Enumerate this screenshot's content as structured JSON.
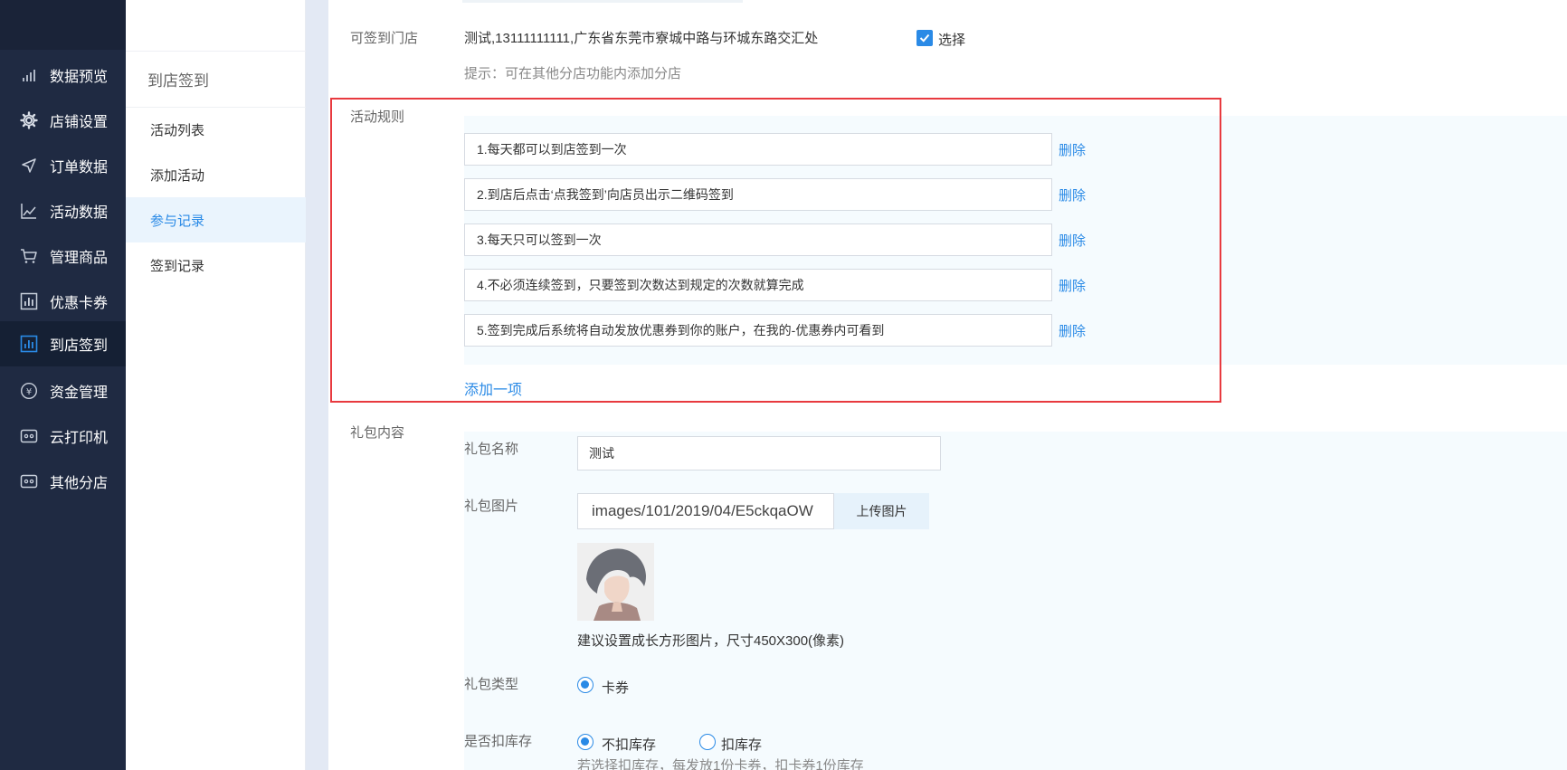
{
  "sidebar": {
    "items": [
      {
        "label": "数据预览",
        "icon": "bar-chart-small-icon"
      },
      {
        "label": "店铺设置",
        "icon": "gear-icon"
      },
      {
        "label": "订单数据",
        "icon": "send-arrow-icon"
      },
      {
        "label": "活动数据",
        "icon": "line-chart-icon"
      },
      {
        "label": "管理商品",
        "icon": "cart-icon"
      },
      {
        "label": "优惠卡券",
        "icon": "stats-box-icon"
      },
      {
        "label": "到店签到",
        "icon": "stats-box-icon"
      },
      {
        "label": "资金管理",
        "icon": "yen-circle-icon"
      },
      {
        "label": "云打印机",
        "icon": "printer-icon"
      },
      {
        "label": "其他分店",
        "icon": "store-icon"
      }
    ],
    "active_index": 6
  },
  "subnav": {
    "title": "到店签到",
    "items": [
      "活动列表",
      "添加活动",
      "参与记录",
      "签到记录"
    ],
    "active_index": 2
  },
  "form": {
    "store_label": "可签到门店",
    "store_text": "测试,13111111111,广东省东莞市寮城中路与环城东路交汇处",
    "select_label": "选择",
    "select_checked": true,
    "hint": "提示：可在其他分店功能内添加分店",
    "rules_label": "活动规则",
    "rules": [
      "1.每天都可以到店签到一次",
      "2.到店后点击‘点我签到’向店员出示二维码签到",
      "3.每天只可以签到一次",
      "4.不必须连续签到，只要签到次数达到规定的次数就算完成",
      "5.签到完成后系统将自动发放优惠券到你的账户，在我的-优惠券内可看到"
    ],
    "delete_label": "删除",
    "add_label": "添加一项",
    "gift_label": "礼包内容",
    "gift_name_label": "礼包名称",
    "gift_name_value": "测试",
    "gift_image_label": "礼包图片",
    "gift_image_path": "images/101/2019/04/E5ckqaOW",
    "upload_label": "上传图片",
    "image_tip": "建议设置成长方形图片，尺寸450X300(像素)",
    "gift_type_label": "礼包类型",
    "gift_type_option": "卡券",
    "stock_label": "是否扣库存",
    "stock_options": [
      "不扣库存",
      "扣库存"
    ],
    "stock_selected": 0,
    "stock_tip": "若选择扣库存，每发放1份卡券，扣卡券1份库存"
  },
  "colors": {
    "sidebar_bg": "#1f2a42",
    "accent": "#2a8ae6",
    "highlight": "#e83a3f"
  }
}
